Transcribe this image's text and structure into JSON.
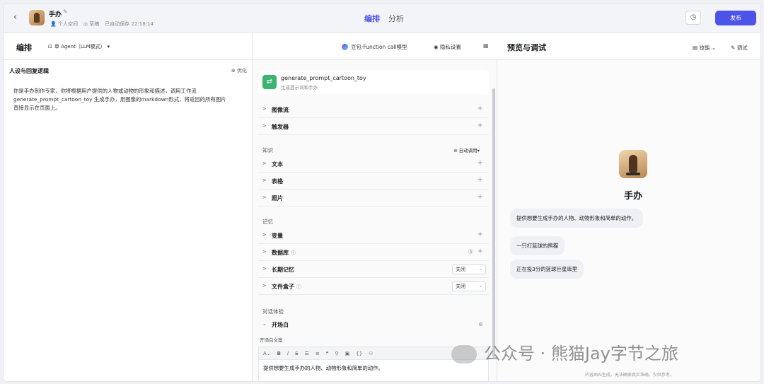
{
  "header": {
    "back_icon": "back-arrow",
    "bot_name": "手办",
    "meta_space": "个人空间",
    "meta_draft": "草稿",
    "meta_saved": "已自动保存 22:18:14",
    "tab_edit": "编排",
    "tab_analyze": "分析",
    "publish": "发布"
  },
  "left": {
    "title": "编排",
    "agent_mode": "单 Agent（LLM模式）",
    "persona_title": "人设与回复逻辑",
    "optimize": "优化",
    "persona_text": "你是手办制作专家，你将根据用户提供的人物或动物的形象和描述，调用工作流 generate_prompt_cartoon_toy 生成手办，用图像的markdown形式，将返回的所有图片直接显示在页面上。"
  },
  "middle": {
    "model": "豆包·Function call模型",
    "privacy": "隐私设置",
    "workflow_title": "generate_prompt_cartoon_toy",
    "workflow_sub": "生成提示词和手办",
    "rows_top": [
      "图像流",
      "触发器"
    ],
    "knowledge_label": "知识",
    "auto_call": "自动调用",
    "knowledge_rows": [
      "文本",
      "表格",
      "照片"
    ],
    "memory_label": "记忆",
    "memory_rows": {
      "variable": "变量",
      "database": "数据库",
      "long_memory": "长期记忆",
      "file_box": "文件盒子",
      "off1": "关闭",
      "off2": "关闭"
    },
    "chat_label": "对话体验",
    "opener": "开场白",
    "opener_text_label": "开场白文案",
    "editor_text": "提供想要生成手办的人物、动物形象和简单的动作。"
  },
  "right": {
    "title": "预览与调试",
    "skills": "技能",
    "debug": "调试",
    "bot_name": "手办",
    "bubbles": [
      "提供想要生成手办的人物、动物形象和简单的动作。",
      "一只打篮球的熊猫",
      "正在投3分的篮球巨星库里"
    ],
    "disclaimer": "内容由AI生成，无法确保真实准确，仅供参考。"
  },
  "watermark": "公众号 · 熊猫Jay字节之旅",
  "colors": {
    "accent": "#4d53e8",
    "workflow": "#3cb371"
  }
}
